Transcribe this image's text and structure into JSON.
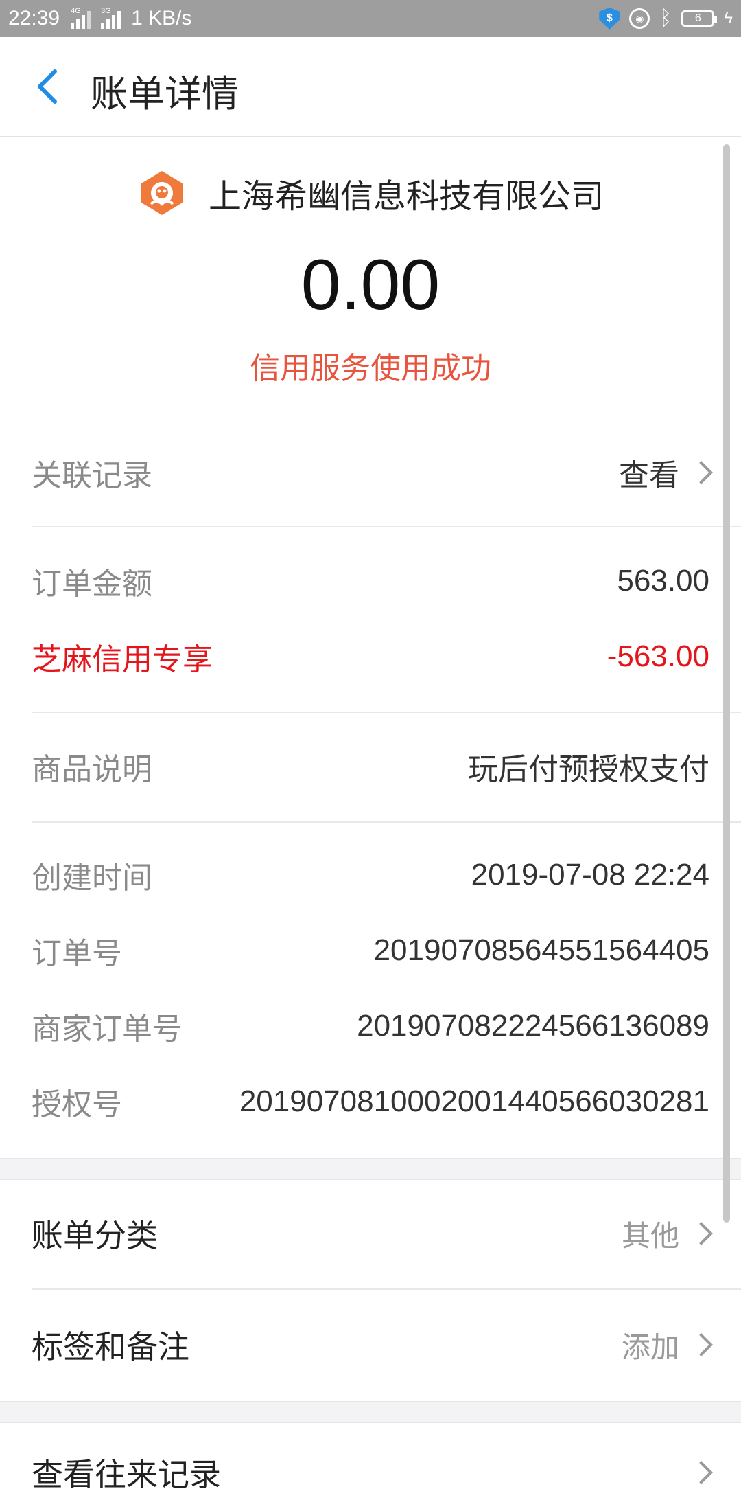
{
  "status_bar": {
    "time": "22:39",
    "signal1_tag": "4G",
    "signal2_tag": "3G",
    "speed": "1 KB/s",
    "battery": "6"
  },
  "header": {
    "title": "账单详情"
  },
  "merchant": {
    "name": "上海希幽信息科技有限公司"
  },
  "summary": {
    "amount": "0.00",
    "status": "信用服务使用成功"
  },
  "related": {
    "label": "关联记录",
    "action": "查看"
  },
  "order": {
    "amount_label": "订单金额",
    "amount_value": "563.00",
    "discount_label": "芝麻信用专享",
    "discount_value": "-563.00"
  },
  "product": {
    "label": "商品说明",
    "value": "玩后付预授权支付"
  },
  "details": {
    "created_label": "创建时间",
    "created_value": "2019-07-08 22:24",
    "order_no_label": "订单号",
    "order_no_value": "2019070856455156440 5",
    "merchant_no_label": "商家订单号",
    "merchant_no_value": "201907082224566136089",
    "auth_no_label": "授权号",
    "auth_no_value": "2019070810002001440566030281"
  },
  "category": {
    "label": "账单分类",
    "value": "其他"
  },
  "tags": {
    "label": "标签和备注",
    "value": "添加"
  },
  "history": {
    "label": "查看往来记录"
  },
  "colors": {
    "status_orange": "#e8553f",
    "discount_red": "#e4161c",
    "back_blue": "#1f8ce6"
  }
}
